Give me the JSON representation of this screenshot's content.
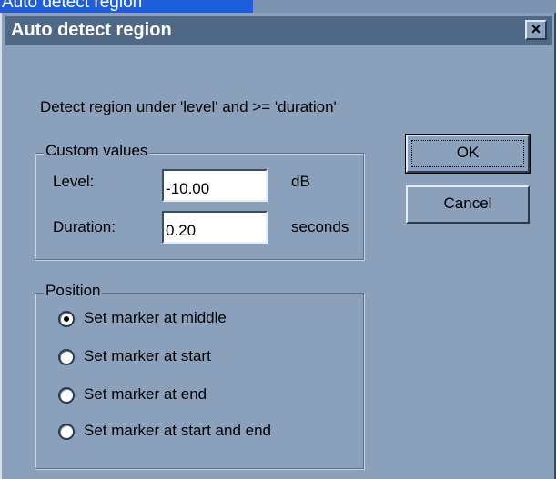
{
  "outer_window": {
    "title_fragment": "Auto detect region"
  },
  "dialog": {
    "title": "Auto detect region",
    "close_glyph": "×",
    "description": "Detect region under 'level' and >=  'duration'",
    "custom_values": {
      "legend": "Custom values",
      "level_label": "Level:",
      "level_value": "-10.00",
      "level_unit": "dB",
      "duration_label": "Duration:",
      "duration_value": "0.20",
      "duration_unit": "seconds"
    },
    "position": {
      "legend": "Position",
      "options": [
        {
          "label": "Set marker at middle",
          "selected": true
        },
        {
          "label": "Set marker at start",
          "selected": false
        },
        {
          "label": "Set marker at end",
          "selected": false
        },
        {
          "label": "Set marker at start and end",
          "selected": false
        }
      ]
    },
    "buttons": {
      "ok": "OK",
      "cancel": "Cancel"
    }
  },
  "colors": {
    "dialog_bg": "#8aa0bb",
    "titlebar": "#4e6885",
    "outer_title_bar": "#1e5edc"
  }
}
